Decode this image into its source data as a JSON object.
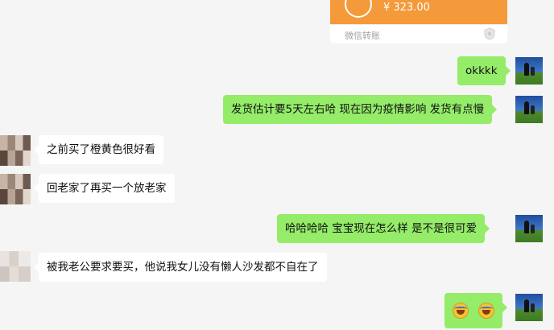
{
  "transfer": {
    "amount": "¥ 323.00",
    "source": "微信转账"
  },
  "messages": [
    {
      "side": "out",
      "text": "okkkk"
    },
    {
      "side": "out",
      "text": "发货估计要5天左右哈  现在因为疫情影响  发货有点慢"
    },
    {
      "side": "in",
      "text": "之前买了橙黄色很好看"
    },
    {
      "side": "in",
      "text": "回老家了再买一个放老家"
    },
    {
      "side": "out",
      "text": "哈哈哈哈    宝宝现在怎么样    是不是很可爱"
    },
    {
      "side": "in",
      "text": "被我老公要求要买，他说我女儿没有懒人沙发都不自在了"
    },
    {
      "side": "out",
      "emoji": [
        "crying-laughing-emoji",
        "crying-laughing-emoji"
      ]
    }
  ]
}
